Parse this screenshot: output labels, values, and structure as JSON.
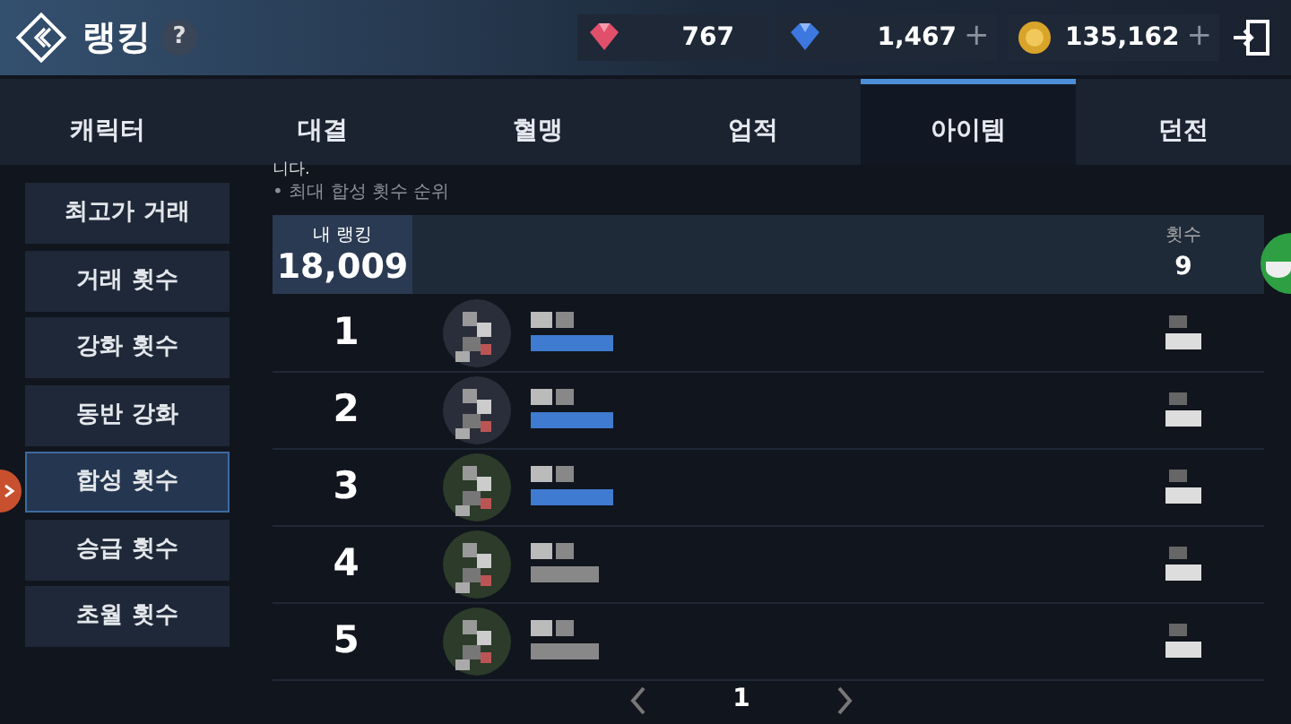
{
  "header": {
    "title": "랭킹",
    "help": "?",
    "currencies": [
      {
        "kind": "ruby",
        "amount": "767"
      },
      {
        "kind": "sapphire",
        "amount": "1,467",
        "add": "+"
      },
      {
        "kind": "gold",
        "amount": "135,162",
        "add": "+"
      }
    ]
  },
  "tabs": [
    {
      "label": "캐릭터",
      "selected": false
    },
    {
      "label": "대결",
      "selected": false
    },
    {
      "label": "혈맹",
      "selected": false
    },
    {
      "label": "업적",
      "selected": false
    },
    {
      "label": "아이템",
      "selected": true
    },
    {
      "label": "던전",
      "selected": false
    }
  ],
  "sidebar": {
    "items": [
      {
        "label": "최고가 거래",
        "selected": false
      },
      {
        "label": "거래 횟수",
        "selected": false
      },
      {
        "label": "강화 횟수",
        "selected": false
      },
      {
        "label": "동반 강화",
        "selected": false
      },
      {
        "label": "합성 횟수",
        "selected": true
      },
      {
        "label": "승급 횟수",
        "selected": false
      },
      {
        "label": "초월 횟수",
        "selected": false
      }
    ]
  },
  "notice": {
    "cut_line": "니다.",
    "hint": "• 최대 합성 횟수 순위"
  },
  "my_ranking": {
    "label": "내 랭킹",
    "rank": "18,009",
    "count_label": "횟수",
    "count": "9"
  },
  "rows": [
    {
      "rank": "1"
    },
    {
      "rank": "2"
    },
    {
      "rank": "3"
    },
    {
      "rank": "4"
    },
    {
      "rank": "5"
    }
  ],
  "pager": {
    "page": "1"
  }
}
